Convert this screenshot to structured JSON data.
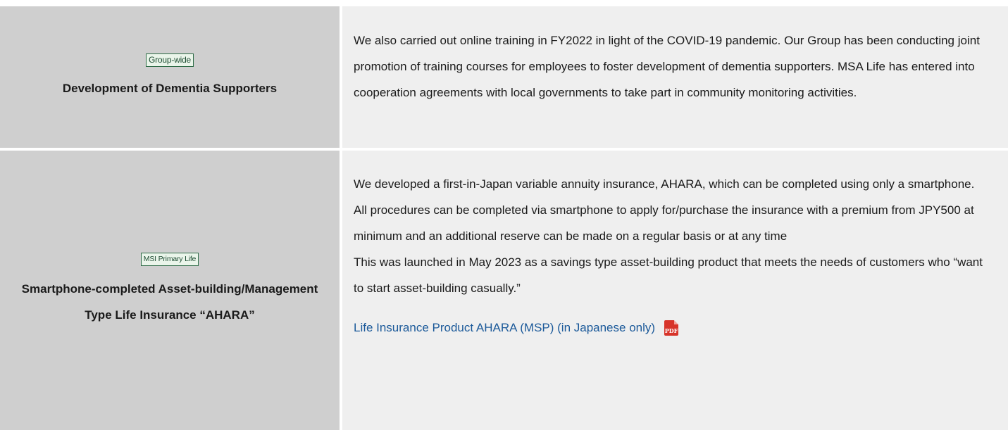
{
  "rows": [
    {
      "badge": "Group-wide",
      "title": "Development of Dementia Supporters",
      "paragraphs": [
        "We also carried out online training in FY2022 in light of the COVID-19 pandemic. Our Group has been conducting joint promotion of training courses for employees to foster development of dementia supporters. MSA Life has entered into cooperation agreements with local governments to take part in community monitoring activities."
      ]
    },
    {
      "badge": "MSI Primary Life",
      "title": "Smartphone-completed Asset-building/Management Type Life Insurance “AHARA”",
      "paragraphs": [
        "We developed a first-in-Japan variable annuity insurance, AHARA, which can be completed using only a smartphone.",
        "All procedures can be completed via smartphone to apply for/purchase the insurance with a premium from JPY500 at minimum and an additional reserve can be made on a regular basis or at any time",
        "This was launched in May 2023 as a savings type asset-building product that meets the needs of customers who “want to start asset-building casually.”"
      ],
      "link": {
        "text": "Life Insurance Product AHARA (MSP) (in Japanese only)",
        "icon": "pdf-icon",
        "icon_text": "PDF"
      }
    }
  ],
  "colors": {
    "label_bg": "#cfcfcf",
    "content_bg": "#efefef",
    "link": "#1c5a9a",
    "badge_border": "#2e6b47",
    "pdf_red": "#d7342a"
  }
}
